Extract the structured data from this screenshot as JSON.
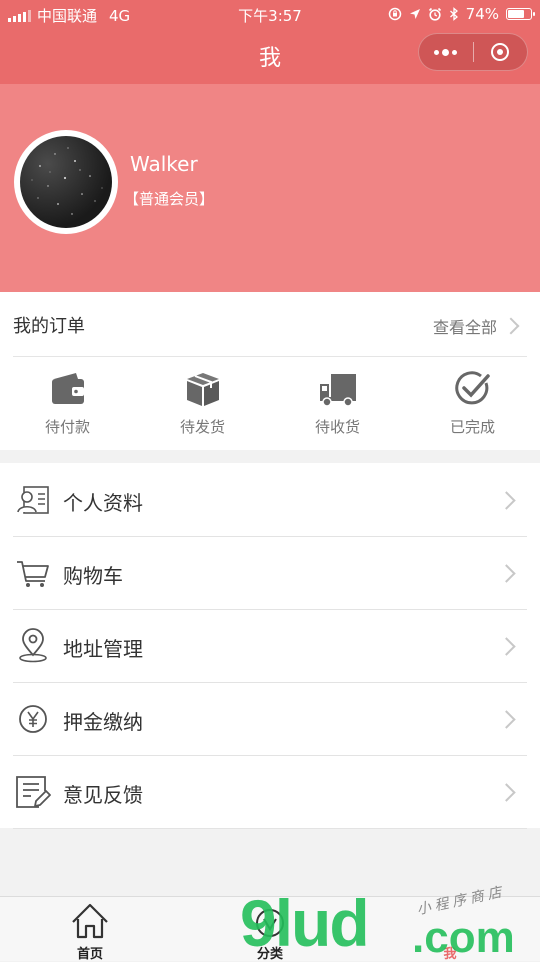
{
  "status_bar": {
    "carrier": "中国联通",
    "network": "4G",
    "time": "下午3:57",
    "battery": "74%",
    "battery_level": 0.74
  },
  "navbar": {
    "title": "我"
  },
  "profile": {
    "username": "Walker",
    "level": "【普通会员】"
  },
  "orders": {
    "title": "我的订单",
    "view_all": "查看全部",
    "tabs": [
      {
        "label": "待付款",
        "icon": "wallet-icon"
      },
      {
        "label": "待发货",
        "icon": "box-icon"
      },
      {
        "label": "待收货",
        "icon": "truck-icon"
      },
      {
        "label": "已完成",
        "icon": "check-circle-icon"
      }
    ]
  },
  "menu": {
    "items": [
      {
        "label": "个人资料",
        "icon": "profile-card-icon"
      },
      {
        "label": "购物车",
        "icon": "cart-icon"
      },
      {
        "label": "地址管理",
        "icon": "location-pin-icon"
      },
      {
        "label": "押金缴纳",
        "icon": "yen-icon"
      },
      {
        "label": "意见反馈",
        "icon": "feedback-icon"
      }
    ]
  },
  "tabbar": {
    "items": [
      {
        "label": "首页",
        "icon": "home-icon"
      },
      {
        "label": "分类",
        "icon": "category-icon"
      },
      {
        "label": "我",
        "icon": "user-icon",
        "active": true
      }
    ]
  },
  "watermark": {
    "main": "9lud",
    "suffix": ".com",
    "sub": "小程序商店"
  },
  "colors": {
    "header": "#e96b6b",
    "profile_bg": "#f08585",
    "accent": "#e96b6b"
  }
}
